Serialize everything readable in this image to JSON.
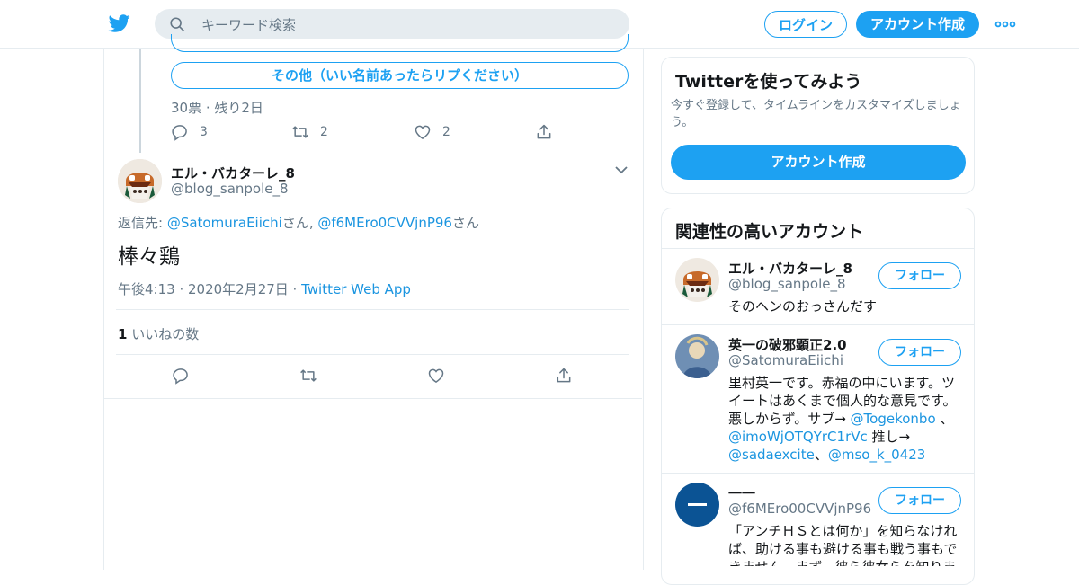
{
  "header": {
    "search_placeholder": "キーワード検索",
    "login_label": "ログイン",
    "signup_label": "アカウント作成"
  },
  "parent_tweet": {
    "poll_option_partial": "",
    "poll_option": "その他（いい名前あったらリプください）",
    "poll_meta": "30票 · 残り2日",
    "reply_count": "3",
    "retweet_count": "2",
    "like_count": "2"
  },
  "tweet": {
    "display_name": "エル・バカターレ_8",
    "handle": "@blog_sanpole_8",
    "reply_prefix": "返信先: ",
    "reply_to_1": "@SatomuraEiichi",
    "reply_suffix_1": "さん, ",
    "reply_to_2": "@f6MEro0CVVjnP96",
    "reply_suffix_2": "さん",
    "text": "棒々鶏",
    "timestamp": "午後4:13 · 2020年2月27日 · ",
    "source": "Twitter Web App",
    "like_count": "1",
    "like_label": " いいねの数"
  },
  "signup_card": {
    "title": "Twitterを使ってみよう",
    "description": "今すぐ登録して、タイムラインをカスタマイズしましょう。",
    "button_label": "アカウント作成"
  },
  "related": {
    "title": "関連性の高いアカウント",
    "follow_label": "フォロー",
    "accounts": [
      {
        "name": "エル・バカターレ_8",
        "handle": "@blog_sanpole_8",
        "bio": "そのヘンのおっさんだす"
      },
      {
        "name": "英一の破邪顕正2.0",
        "handle": "@SatomuraEiichi",
        "bio_1": "里村英一です。赤福の中にいます。ツイートはあくまで個人的な意見です。悪しからず。サブ→ ",
        "link_1": "@Togekonbo",
        "bio_2": " 、",
        "link_2": "@imoWjOTQYrC1rVc",
        "bio_3": " 推し→ ",
        "link_3": "@sadaexcite",
        "bio_4": "、",
        "link_4": "@mso_k_0423"
      },
      {
        "name": "一一",
        "handle": "@f6MEro00CVVjnP96",
        "bio": "「アンチＨＳとは何か」を知らなければ、助ける事も避ける事も戦う事もできません。まず、彼ら彼女らを知りま"
      }
    ]
  },
  "colors": {
    "accent": "#1da1f2",
    "link": "#1b95e0",
    "muted": "#657786",
    "border": "#e6ecf0"
  }
}
